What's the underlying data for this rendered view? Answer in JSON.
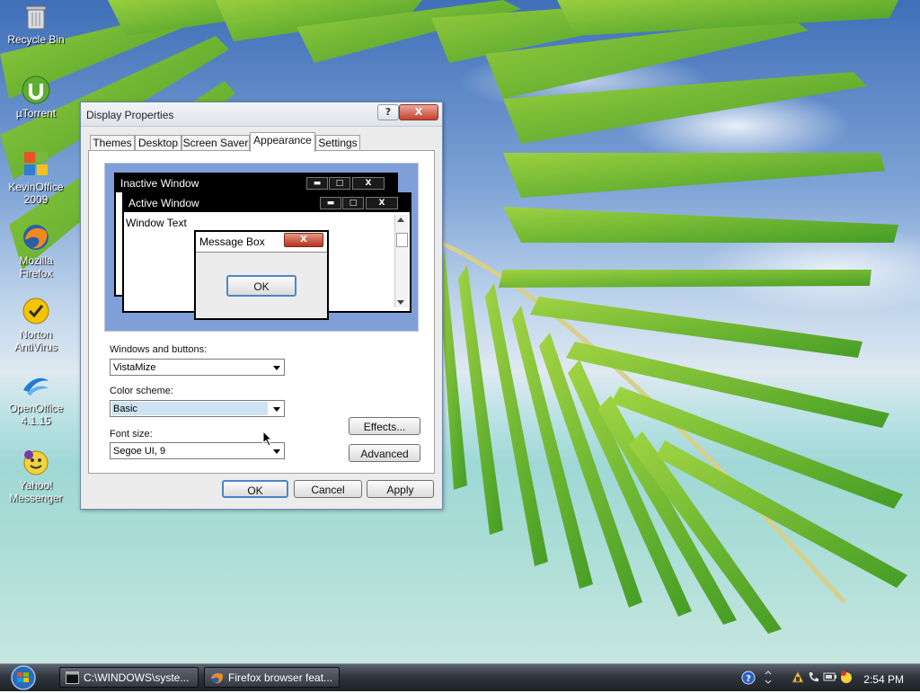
{
  "desktop": {
    "icons": [
      {
        "label": "Recycle Bin",
        "icon": "recycle-bin-icon"
      },
      {
        "label": "µTorrent",
        "icon": "utorrent-icon"
      },
      {
        "label_line1": "KevinOffice",
        "label_line2": "2009",
        "icon": "kevinoffice-icon"
      },
      {
        "label_line1": "Mozilla",
        "label_line2": "Firefox",
        "icon": "firefox-icon"
      },
      {
        "label_line1": "Norton",
        "label_line2": "AntiVirus",
        "icon": "norton-icon"
      },
      {
        "label_line1": "OpenOffice",
        "label_line2": "4.1.15",
        "icon": "openoffice-icon"
      },
      {
        "label_line1": "Yahoo!",
        "label_line2": "Messenger",
        "icon": "yahoo-messenger-icon"
      }
    ]
  },
  "dialog": {
    "title": "Display Properties",
    "help_label": "?",
    "close_label": "X",
    "tabs": [
      {
        "label": "Themes"
      },
      {
        "label": "Desktop"
      },
      {
        "label": "Screen Saver"
      },
      {
        "label": "Appearance",
        "active": true
      },
      {
        "label": "Settings"
      }
    ],
    "preview": {
      "inactive_title": "Inactive Window",
      "active_title": "Active Window",
      "window_text": "Window Text",
      "message_box_title": "Message Box",
      "message_box_ok": "OK",
      "minimize_glyph": "▬",
      "maximize_glyph": "□",
      "close_glyph": "X"
    },
    "windows_buttons": {
      "label": "Windows and buttons:",
      "value": "VistaMize"
    },
    "color_scheme": {
      "label": "Color scheme:",
      "value": "Basic"
    },
    "font_size": {
      "label": "Font size:",
      "value": "Segoe UI, 9"
    },
    "effects_label": "Effects...",
    "advanced_label": "Advanced",
    "ok_label": "OK",
    "cancel_label": "Cancel",
    "apply_label": "Apply"
  },
  "taskbar": {
    "tasks": [
      {
        "label": "C:\\WINDOWS\\syste...",
        "icon": "console-window-icon"
      },
      {
        "label": "Firefox browser feat...",
        "icon": "firefox-icon"
      }
    ],
    "clock": "2:54 PM"
  },
  "colors": {
    "selection_highlight": "#cfe3f5",
    "preview_background": "#7f9fd9",
    "close_button": "#c8402e"
  }
}
